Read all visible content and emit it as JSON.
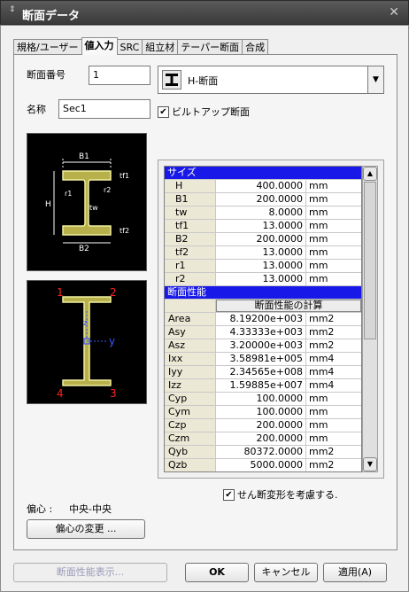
{
  "window": {
    "title": "断面データ",
    "grip": "⇕",
    "close": "✕"
  },
  "tabs": [
    "規格/ユーザー",
    "値入力",
    "SRC",
    "組立材",
    "テーパー断面",
    "合成"
  ],
  "form": {
    "section_number_label": "断面番号",
    "section_number": "1",
    "name_label": "名称",
    "name": "Sec1",
    "section_type": "H-断面",
    "built_up_label": "ビルトアップ断面",
    "built_up_checked": true
  },
  "diagram_top": {
    "labels": {
      "b1": "B1",
      "b2": "B2",
      "tf1": "tf1",
      "tf2": "tf2",
      "r1": "r1",
      "r2": "r2",
      "tw": "tw",
      "h": "H"
    }
  },
  "diagram_bottom": {
    "points": [
      "1",
      "2",
      "3",
      "4"
    ],
    "axis_z": "z",
    "axis_y": "y"
  },
  "grid": {
    "size_section": "サイズ",
    "size_rows": [
      {
        "name": "H",
        "value": "400.0000",
        "unit": "mm"
      },
      {
        "name": "B1",
        "value": "200.0000",
        "unit": "mm"
      },
      {
        "name": "tw",
        "value": "8.0000",
        "unit": "mm"
      },
      {
        "name": "tf1",
        "value": "13.0000",
        "unit": "mm"
      },
      {
        "name": "B2",
        "value": "200.0000",
        "unit": "mm"
      },
      {
        "name": "tf2",
        "value": "13.0000",
        "unit": "mm"
      },
      {
        "name": "r1",
        "value": "13.0000",
        "unit": "mm"
      },
      {
        "name": "r2",
        "value": "13.0000",
        "unit": "mm"
      }
    ],
    "props_section": "断面性能",
    "calc_button": "断面性能の計算",
    "prop_rows": [
      {
        "name": "Area",
        "value": "8.19200e+003",
        "unit": "mm2"
      },
      {
        "name": "Asy",
        "value": "4.33333e+003",
        "unit": "mm2"
      },
      {
        "name": "Asz",
        "value": "3.20000e+003",
        "unit": "mm2"
      },
      {
        "name": "Ixx",
        "value": "3.58981e+005",
        "unit": "mm4"
      },
      {
        "name": "Iyy",
        "value": "2.34565e+008",
        "unit": "mm4"
      },
      {
        "name": "Izz",
        "value": "1.59885e+007",
        "unit": "mm4"
      },
      {
        "name": "Cyp",
        "value": "100.0000",
        "unit": "mm"
      },
      {
        "name": "Cym",
        "value": "100.0000",
        "unit": "mm"
      },
      {
        "name": "Czp",
        "value": "200.0000",
        "unit": "mm"
      },
      {
        "name": "Czm",
        "value": "200.0000",
        "unit": "mm"
      },
      {
        "name": "Qyb",
        "value": "80372.0000",
        "unit": "mm2"
      },
      {
        "name": "Qzb",
        "value": "5000.0000",
        "unit": "mm2"
      }
    ]
  },
  "shear_deform_label": "せん断変形を考慮する.",
  "shear_deform_checked": true,
  "eccentricity": {
    "label": "偏心 :",
    "value": "中央-中央",
    "change_button": "偏心の変更 ..."
  },
  "footer": {
    "show_props": "断面性能表示...",
    "ok": "OK",
    "cancel": "キャンセル",
    "apply": "適用(A)"
  }
}
